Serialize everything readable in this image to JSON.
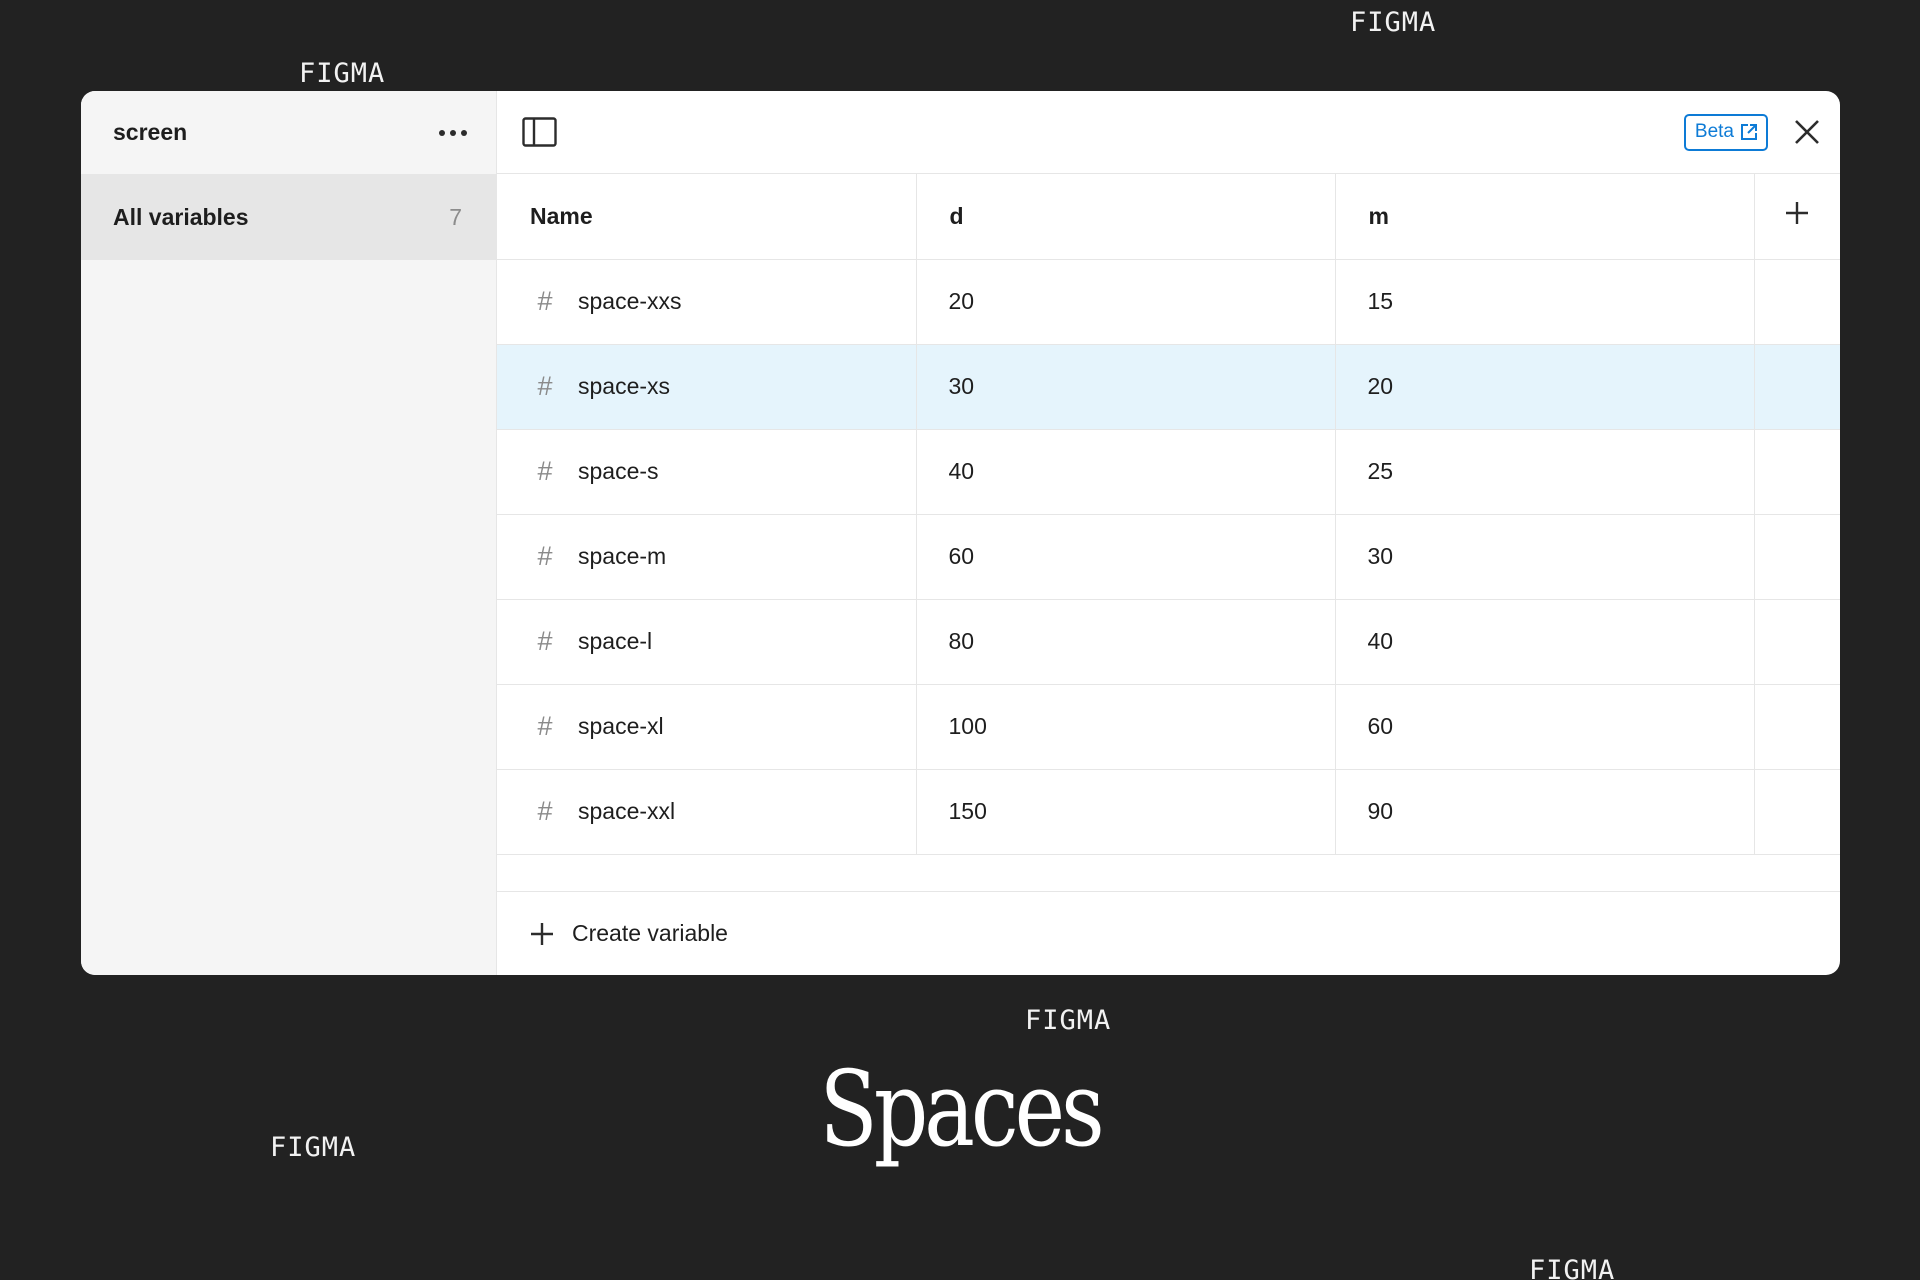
{
  "background": {
    "watermarks": [
      "FIGMA",
      "FIGMA",
      "FIGMA",
      "FIGMA",
      "FIGMA"
    ],
    "title": "Spaces"
  },
  "sidebar": {
    "collection_name": "screen",
    "groups": [
      {
        "label": "All variables",
        "count": "7"
      }
    ]
  },
  "toolbar": {
    "beta_label": "Beta"
  },
  "table": {
    "columns": [
      "Name",
      "d",
      "m"
    ],
    "rows": [
      {
        "name": "space-xxs",
        "d": "20",
        "m": "15"
      },
      {
        "name": "space-xs",
        "d": "30",
        "m": "20"
      },
      {
        "name": "space-s",
        "d": "40",
        "m": "25"
      },
      {
        "name": "space-m",
        "d": "60",
        "m": "30"
      },
      {
        "name": "space-l",
        "d": "80",
        "m": "40"
      },
      {
        "name": "space-xl",
        "d": "100",
        "m": "60"
      },
      {
        "name": "space-xxl",
        "d": "150",
        "m": "90"
      }
    ],
    "selected_row": "space-xs"
  },
  "footer": {
    "create_label": "Create variable"
  },
  "colors": {
    "accent": "#0d7bd6",
    "selected_row": "#e5f4fc",
    "page_bg": "#222222"
  }
}
